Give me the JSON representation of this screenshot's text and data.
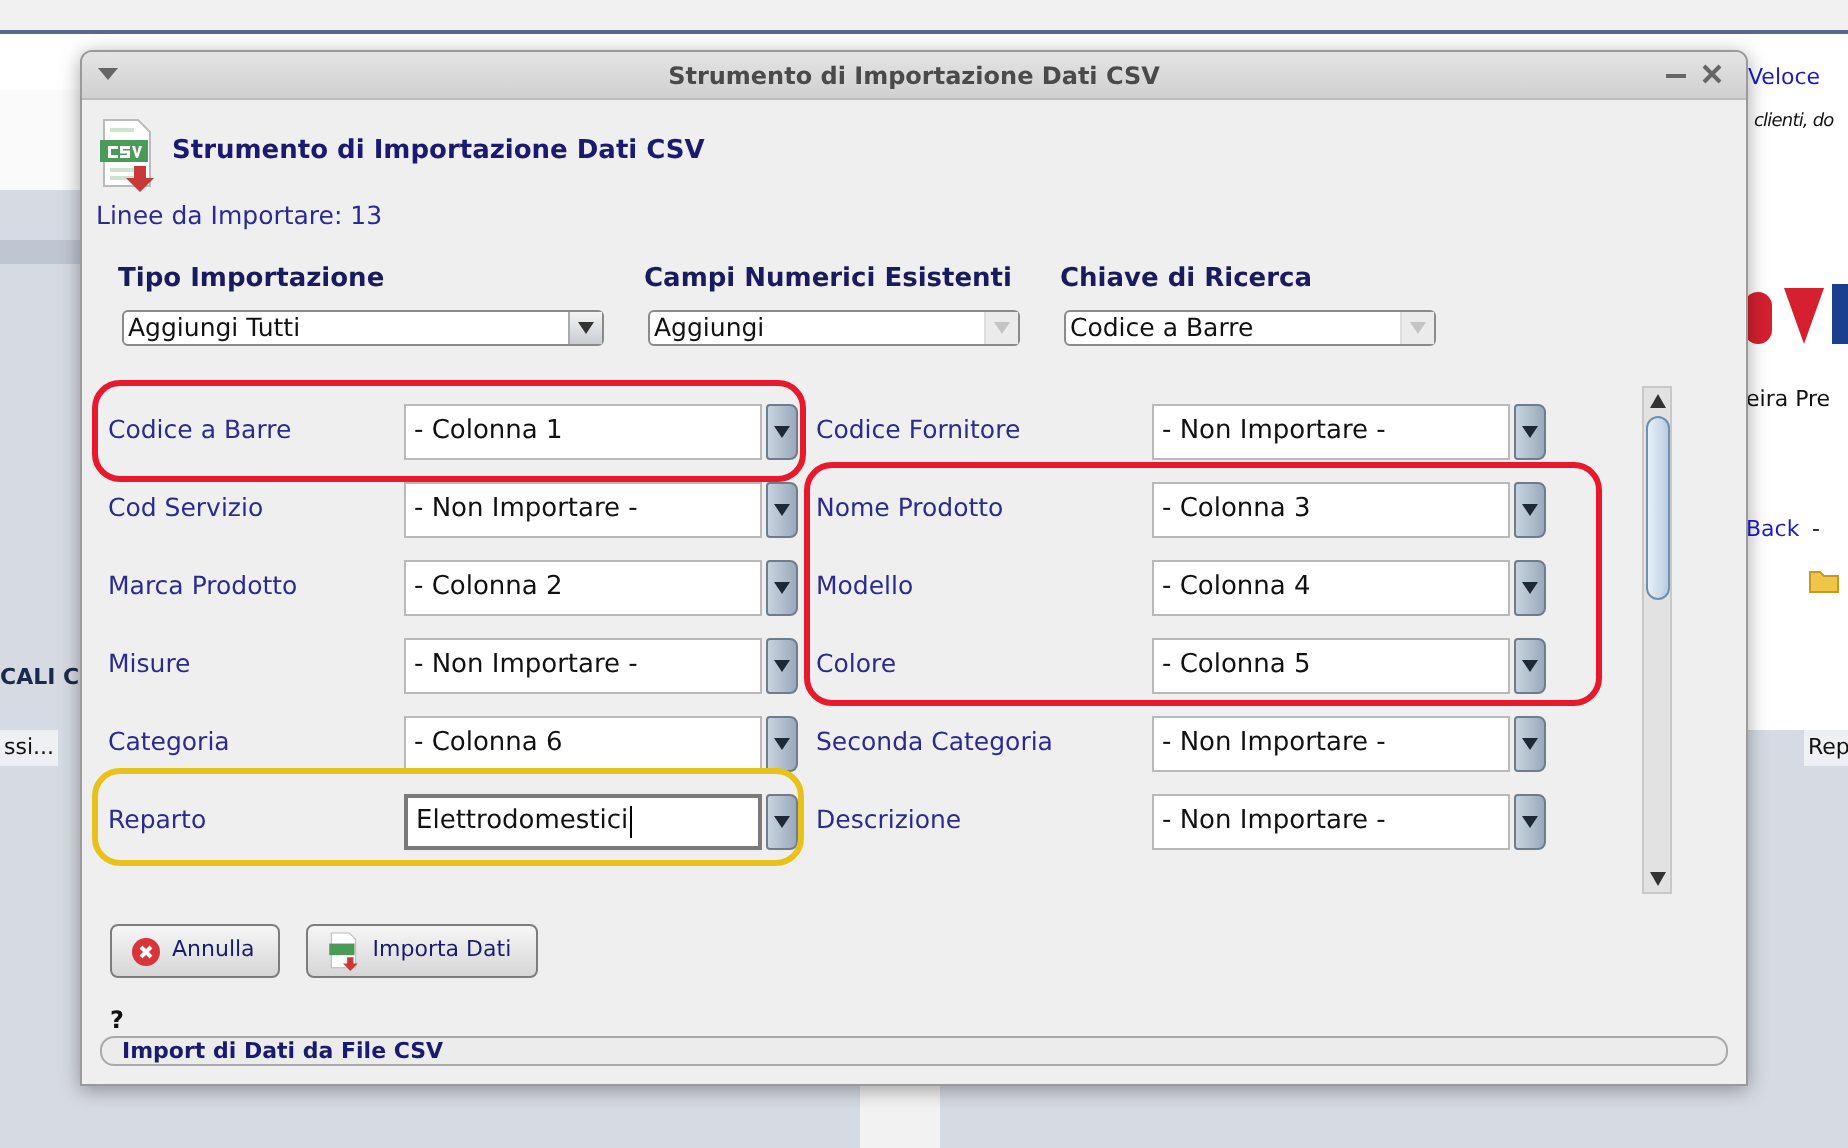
{
  "background": {
    "texts": [
      {
        "text": "Veloce",
        "kind": "link"
      },
      {
        "text": "clienti, do",
        "kind": "italic"
      },
      {
        "text": "eira Pre",
        "kind": "plain"
      },
      {
        "text": "Back",
        "kind": "link"
      },
      {
        "text": "-",
        "kind": "plain"
      },
      {
        "text": "CALI C",
        "kind": "bold"
      },
      {
        "text": "ssi...",
        "kind": "header"
      },
      {
        "text": "Rep",
        "kind": "header"
      }
    ]
  },
  "window": {
    "title": "Strumento di Importazione Dati CSV"
  },
  "header": {
    "title": "Strumento di Importazione Dati CSV",
    "lines": "Linee da Importare: 13"
  },
  "options": [
    {
      "label": "Tipo Importazione",
      "value": "Aggiungi Tutti",
      "disabled": false
    },
    {
      "label": "Campi Numerici Esistenti",
      "value": "Aggiungi",
      "disabled": true
    },
    {
      "label": "Chiave di Ricerca",
      "value": "Codice a Barre",
      "disabled": true
    }
  ],
  "mappings": [
    {
      "label": "Codice a Barre",
      "value": "- Colonna 1",
      "focused": false
    },
    {
      "label": "Codice Fornitore",
      "value": "- Non Importare -",
      "focused": false
    },
    {
      "label": "Cod Servizio",
      "value": "- Non Importare -",
      "focused": false
    },
    {
      "label": "Nome Prodotto",
      "value": "- Colonna 3",
      "focused": false
    },
    {
      "label": "Marca Prodotto",
      "value": "- Colonna 2",
      "focused": false
    },
    {
      "label": "Modello",
      "value": "- Colonna 4",
      "focused": false
    },
    {
      "label": "Misure",
      "value": "- Non Importare -",
      "focused": false
    },
    {
      "label": "Colore",
      "value": "- Colonna 5",
      "focused": false
    },
    {
      "label": "Categoria",
      "value": "- Colonna 6",
      "focused": false
    },
    {
      "label": "Seconda Categoria",
      "value": "- Non Importare -",
      "focused": false
    },
    {
      "label": "Reparto",
      "value": "Elettrodomestici",
      "focused": true
    },
    {
      "label": "Descrizione",
      "value": "- Non Importare -",
      "focused": false
    }
  ],
  "highlights": [
    {
      "color": "#e8192c"
    },
    {
      "color": "#e8192c"
    },
    {
      "color": "#e8c21a"
    }
  ],
  "buttons": [
    {
      "label": "Annulla",
      "kind": "cancel"
    },
    {
      "label": "Importa Dati",
      "kind": "import"
    }
  ],
  "help": "?",
  "status": "Import di Dati da File CSV"
}
